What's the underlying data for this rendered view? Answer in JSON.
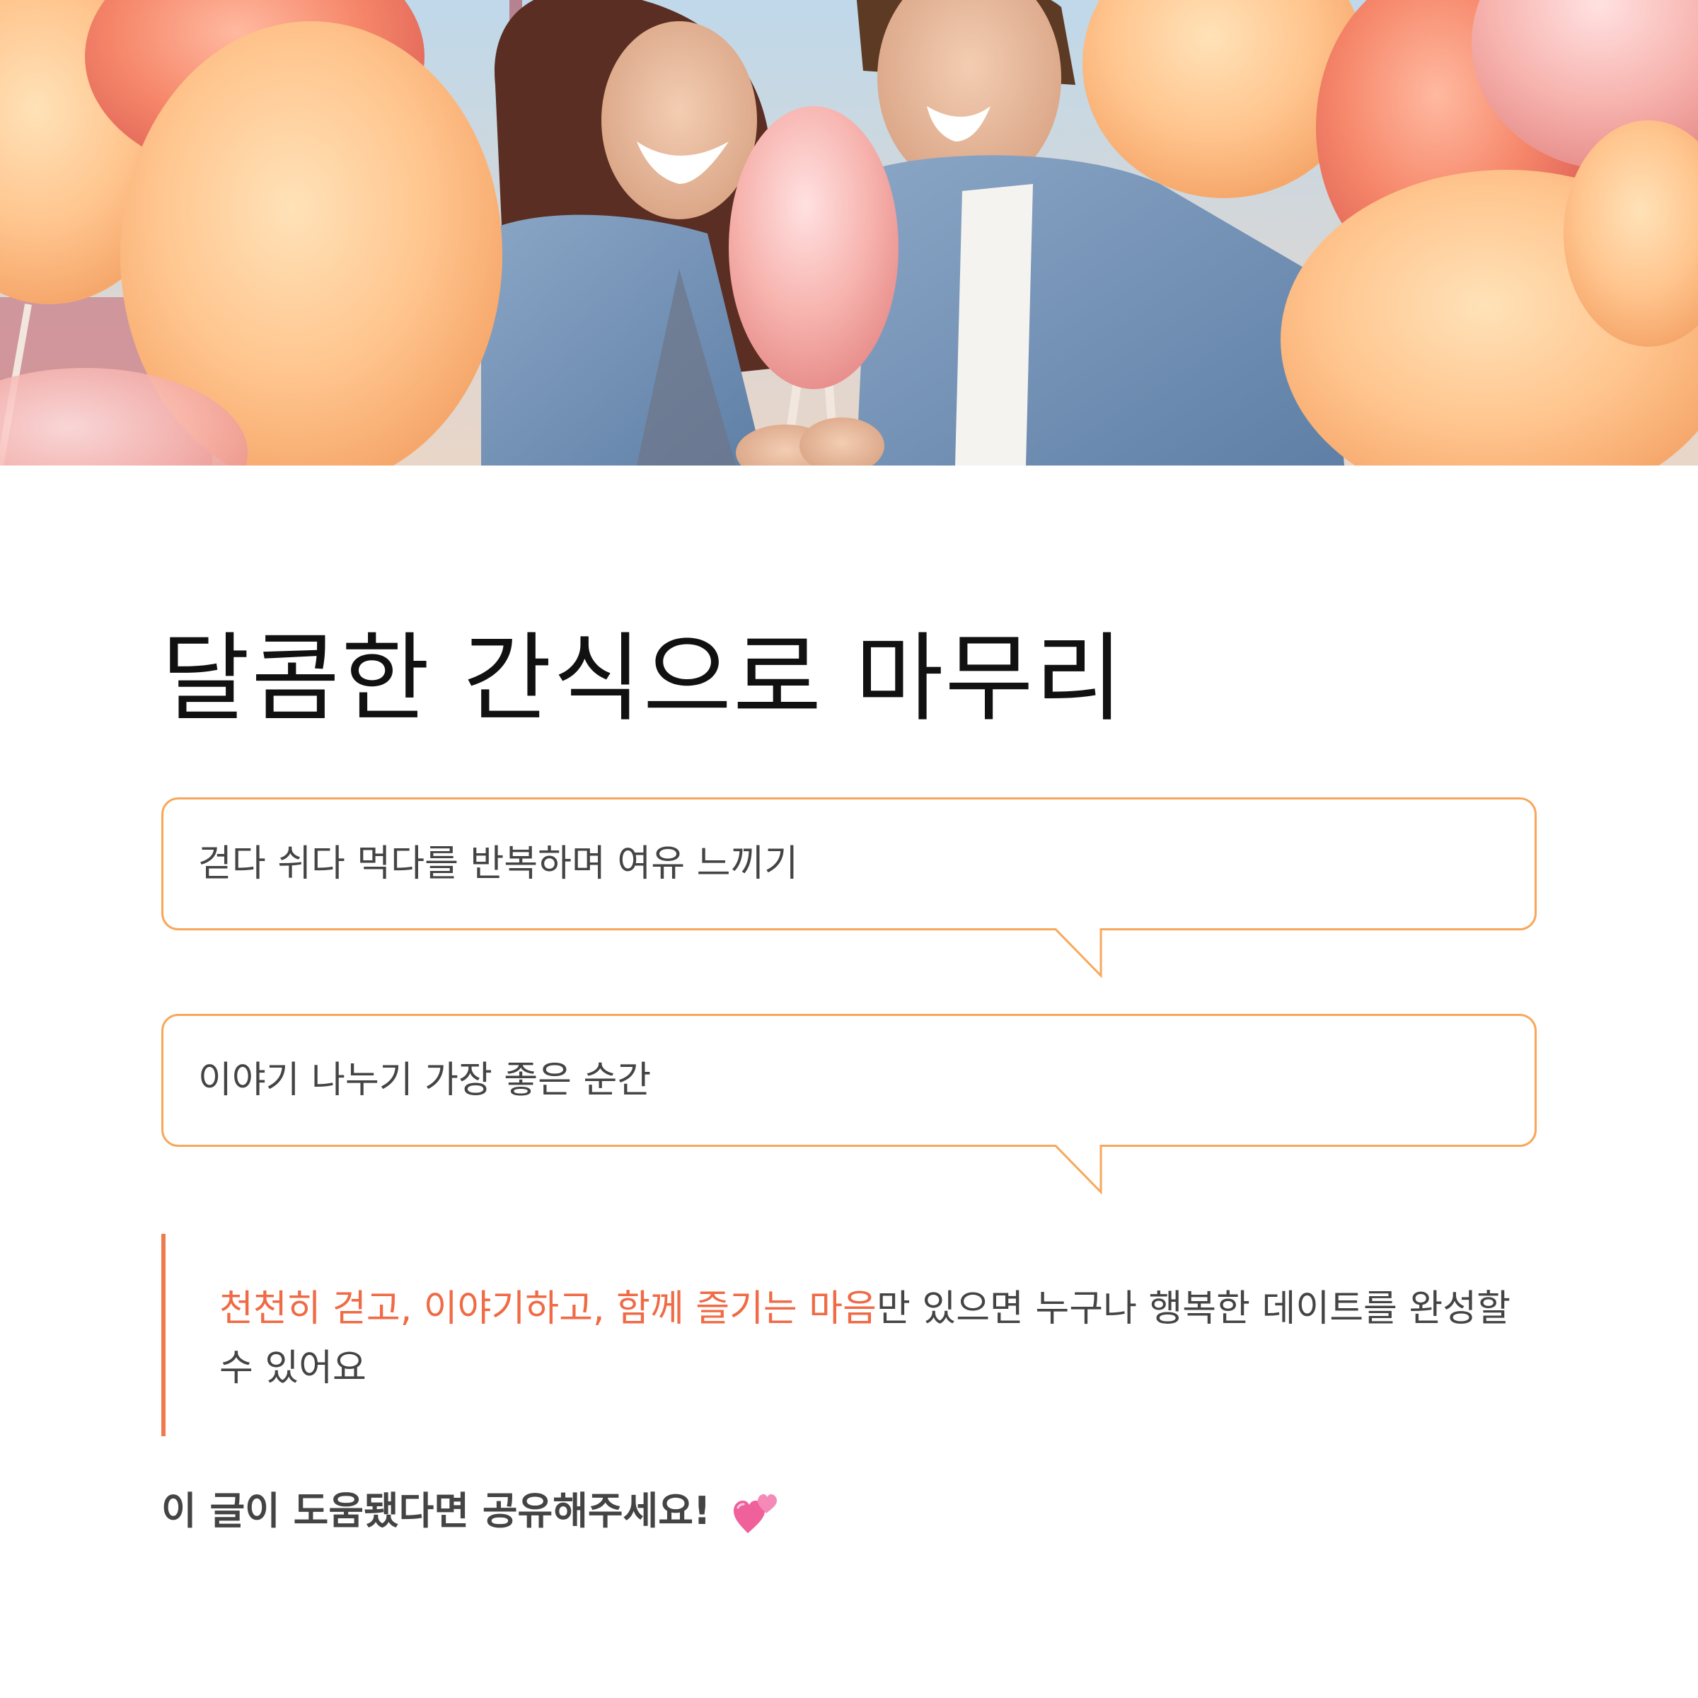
{
  "hero": {
    "image": "couple-sharing-cotton-candy-photo"
  },
  "title": "달콤한 간식으로 마무리",
  "bubbles": [
    {
      "text": "걷다 쉬다 먹다를 반복하며 여유 느끼기"
    },
    {
      "text": "이야기 나누기 가장 좋은 순간"
    }
  ],
  "quote": {
    "highlight": "천천히 걷고, 이야기하고, 함께 즐기는 마음",
    "rest": "만 있으면 누구나 행복한 데이트를 완성할 수 있어요"
  },
  "share": {
    "text": "이 글이 도움됐다면 공유해주세요!",
    "icon": "two-hearts-icon"
  },
  "colors": {
    "bubble_border": "#F8A75A",
    "quote_bar": "#EE7A4E",
    "accent_text": "#F06A45",
    "body_text": "#444444",
    "title_text": "#111111"
  }
}
